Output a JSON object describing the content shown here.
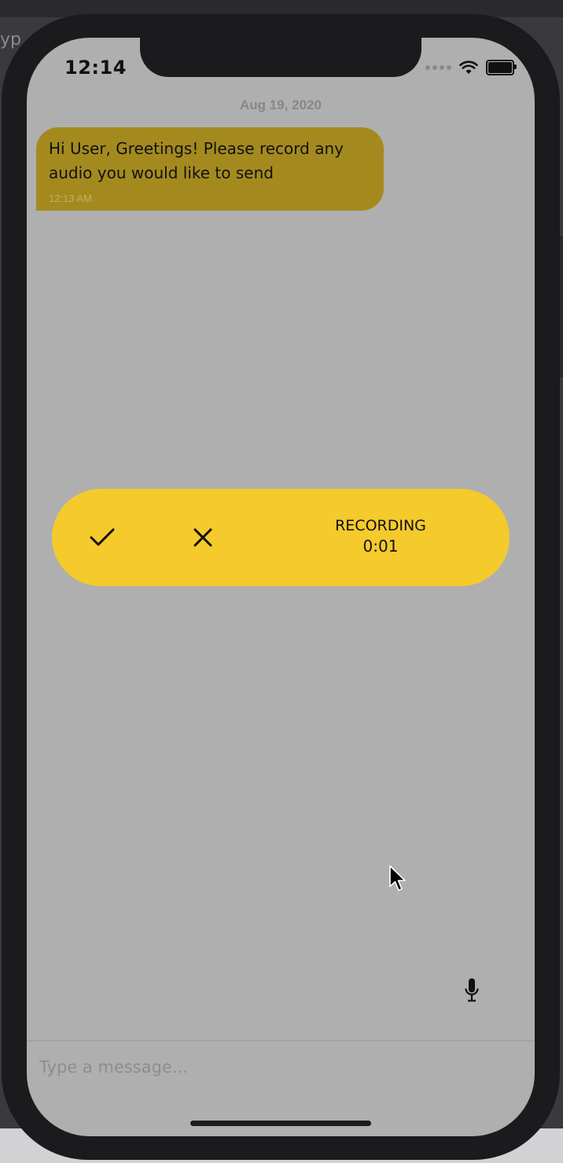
{
  "status_bar": {
    "time": "12:14"
  },
  "chat": {
    "date_header": "Aug 19, 2020",
    "messages": [
      {
        "text": "Hi User, Greetings! Please record any audio you would like to send",
        "time": "12:13 AM"
      }
    ]
  },
  "recorder": {
    "status_label": "RECORDING",
    "elapsed": "0:01",
    "confirm_icon": "checkmark-icon",
    "cancel_icon": "close-icon"
  },
  "composer": {
    "placeholder": "Type a message...",
    "mic_icon": "microphone-icon"
  },
  "colors": {
    "recorder_bg": "#f4ca2c",
    "bubble_bg": "#a48a1e",
    "screen_bg": "#afafaf"
  }
}
